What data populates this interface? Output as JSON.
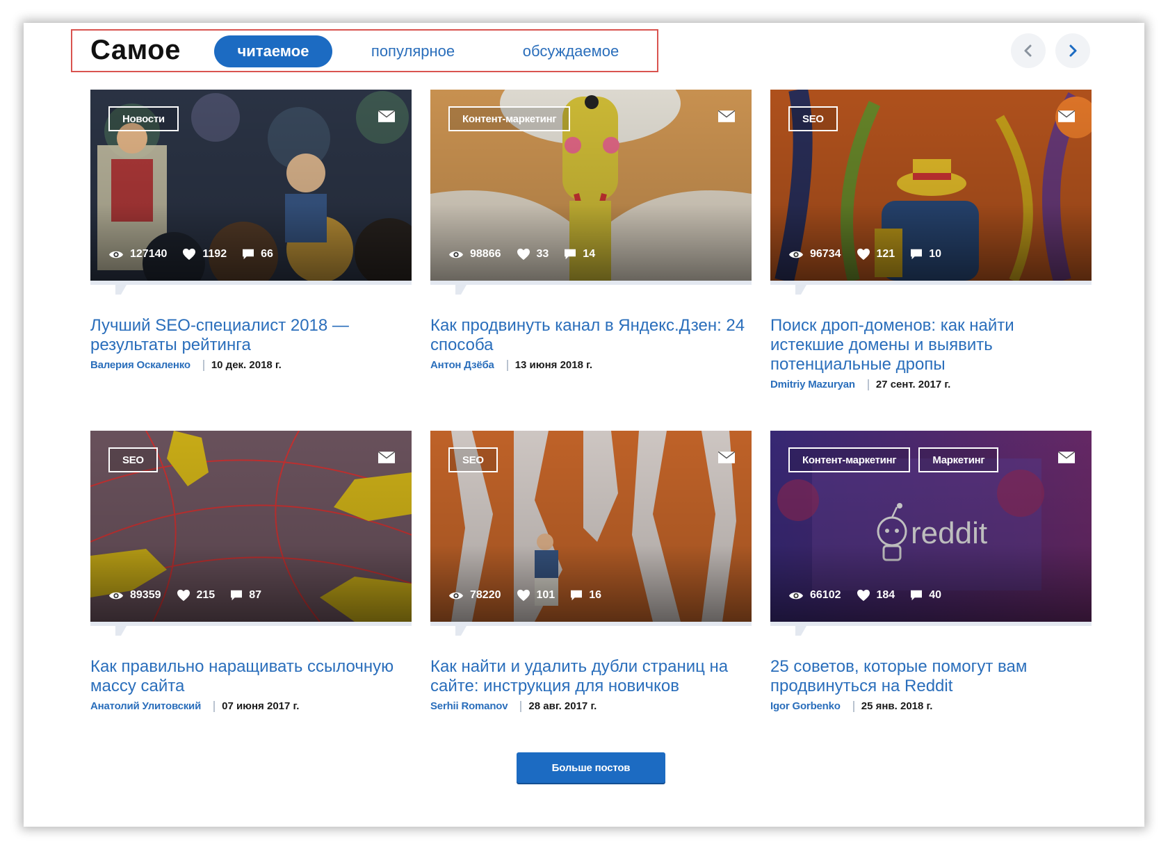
{
  "header": {
    "title": "Самое",
    "tabs": [
      {
        "label": "читаемое",
        "active": true
      },
      {
        "label": "популярное",
        "active": false
      },
      {
        "label": "обсуждаемое",
        "active": false
      }
    ]
  },
  "nav": {
    "prev_icon": "chevron-left-icon",
    "next_icon": "chevron-right-icon"
  },
  "colors": {
    "accent": "#1c6bc2",
    "link": "#2a6ebb",
    "highlight_border": "#d9534f"
  },
  "posts": [
    {
      "tags": [
        "Новости"
      ],
      "views": "127140",
      "likes": "1192",
      "comments": "66",
      "title": "Лучший SEO-специалист 2018 — результаты рейтинга",
      "author": "Валерия Оскаленко",
      "date": "10 дек. 2018 г."
    },
    {
      "tags": [
        "Контент-маркетинг"
      ],
      "views": "98866",
      "likes": "33",
      "comments": "14",
      "title": "Как продвинуть канал в Яндекс.Дзен: 24 способа",
      "author": "Антон Дзёба",
      "date": "13 июня 2018 г."
    },
    {
      "tags": [
        "SEO"
      ],
      "views": "96734",
      "likes": "121",
      "comments": "10",
      "title": "Поиск дроп-доменов: как найти истекшие домены и выявить потенциальные дропы",
      "author": "Dmitriy Mazuryan",
      "date": "27 сент. 2017 г."
    },
    {
      "tags": [
        "SEO"
      ],
      "views": "89359",
      "likes": "215",
      "comments": "87",
      "title": "Как правильно наращивать ссылочную массу сайта",
      "author": "Анатолий Улитовский",
      "date": "07 июня 2017 г."
    },
    {
      "tags": [
        "SEO"
      ],
      "views": "78220",
      "likes": "101",
      "comments": "16",
      "title": "Как найти и удалить дубли страниц на сайте: инструкция для новичков",
      "author": "Serhii Romanov",
      "date": "28 авг. 2017 г."
    },
    {
      "tags": [
        "Контент-маркетинг",
        "Маркетинг"
      ],
      "views": "66102",
      "likes": "184",
      "comments": "40",
      "title": "25 советов, которые помогут вам продвинуться на Reddit",
      "author": "Igor Gorbenko",
      "date": "25 янв. 2018 г.",
      "image_text": "reddit"
    }
  ],
  "more_button": "Больше постов"
}
